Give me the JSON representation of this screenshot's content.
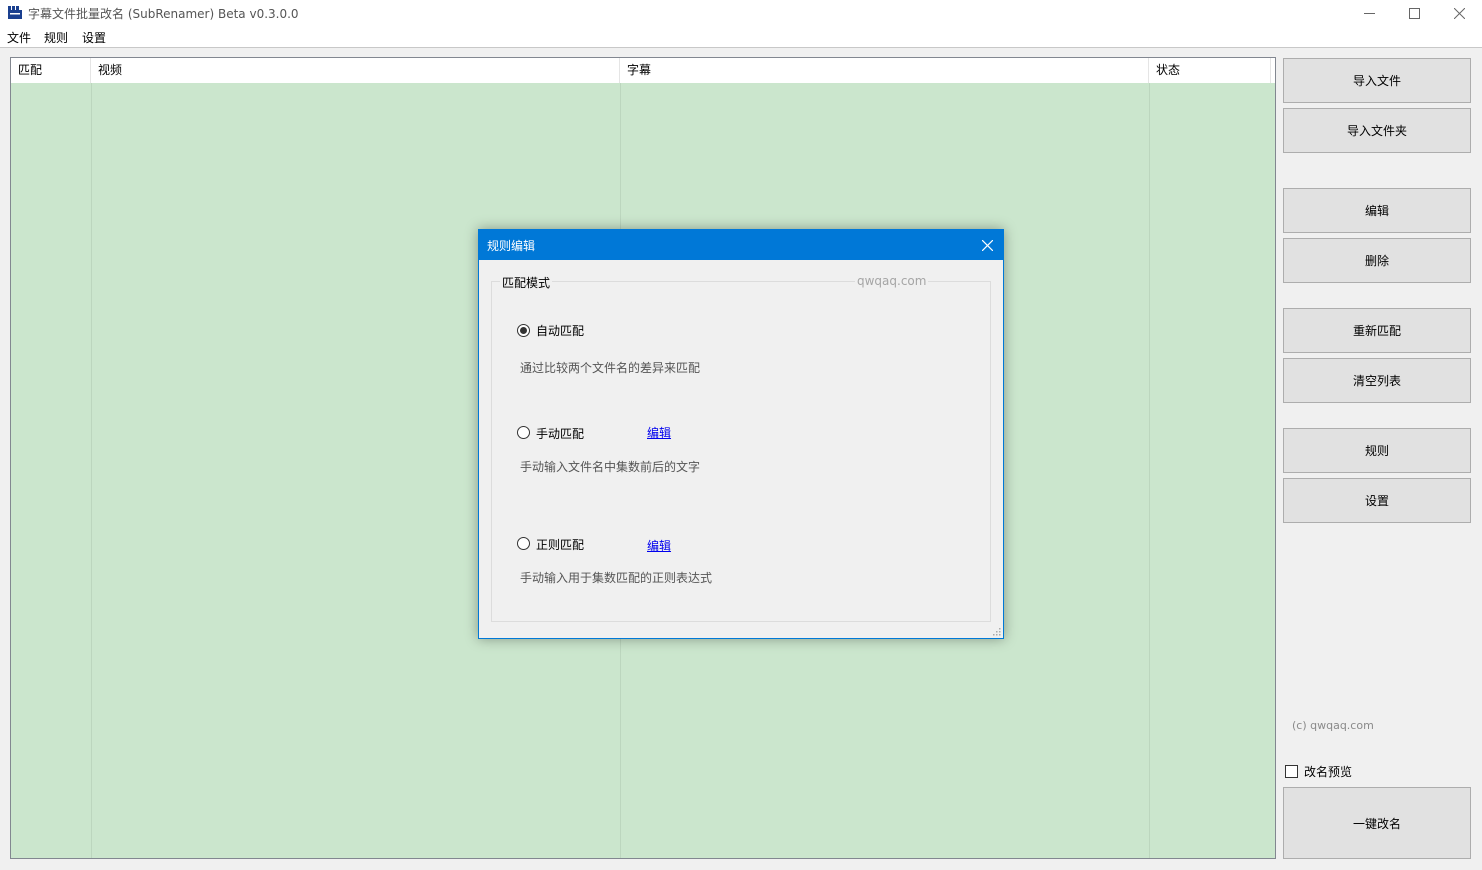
{
  "window": {
    "title": "字幕文件批量改名 (SubRenamer) Beta v0.3.0.0",
    "icon": "clapperboard-icon",
    "controls": [
      "minimize-icon",
      "maximize-icon",
      "close-icon"
    ]
  },
  "menu": {
    "items": [
      {
        "label": "文件"
      },
      {
        "label": "规则"
      },
      {
        "label": "设置"
      }
    ]
  },
  "list": {
    "columns": [
      {
        "label": "匹配"
      },
      {
        "label": "视频"
      },
      {
        "label": "字幕"
      },
      {
        "label": "状态"
      }
    ],
    "background": "#cbe6cd",
    "rows": []
  },
  "side": {
    "import_file": "导入文件",
    "import_folder": "导入文件夹",
    "edit": "编辑",
    "delete": "删除",
    "rematch": "重新匹配",
    "clear_list": "清空列表",
    "rules": "规则",
    "settings": "设置",
    "copyright": "(c) qwqaq.com",
    "preview_label": "改名预览",
    "preview_checked": false,
    "rename_all": "一键改名"
  },
  "dialog": {
    "title": "规则编辑",
    "accent": "#0078d7",
    "group_label": "匹配模式",
    "watermark": "qwqaq.com",
    "options": [
      {
        "label": "自动匹配",
        "checked": true,
        "description": "通过比较两个文件名的差异来匹配"
      },
      {
        "label": "手动匹配",
        "checked": false,
        "edit_link": "编辑",
        "description": "手动输入文件名中集数前后的文字"
      },
      {
        "label": "正则匹配",
        "checked": false,
        "edit_link": "编辑",
        "description": "手动输入用于集数匹配的正则表达式"
      }
    ]
  }
}
